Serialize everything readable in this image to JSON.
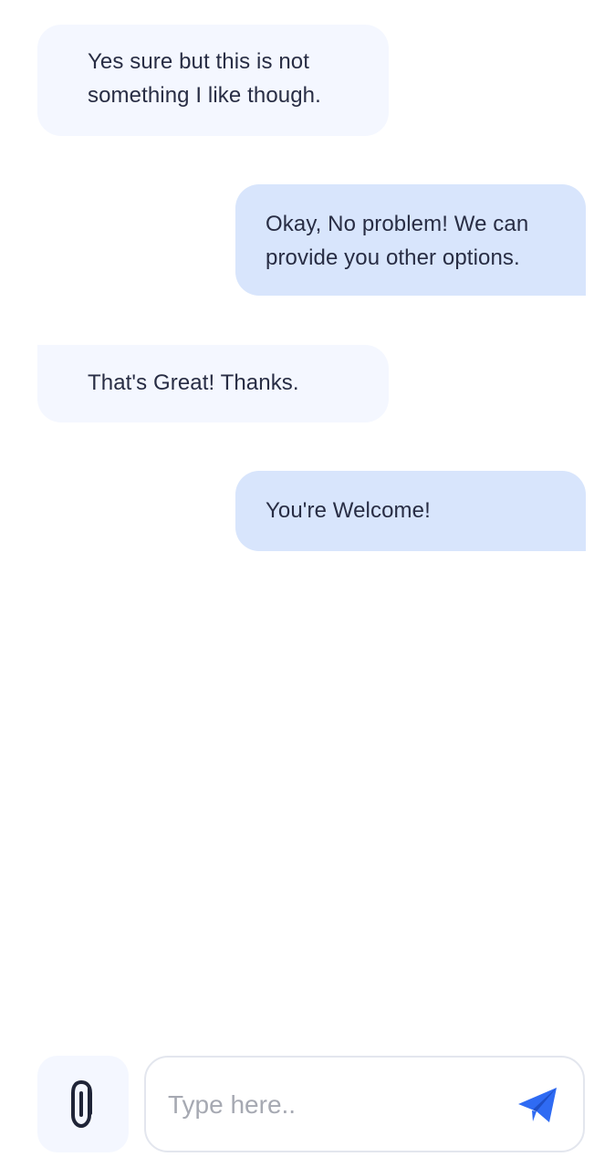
{
  "conversation": {
    "messages": [
      {
        "sender": "incoming",
        "text": "Yes sure but this is not something I like though."
      },
      {
        "sender": "outgoing",
        "text": "Okay, No problem! We can provide you other options."
      },
      {
        "sender": "incoming",
        "text": "That's Great! Thanks."
      },
      {
        "sender": "outgoing",
        "text": "You're Welcome!"
      }
    ]
  },
  "composer": {
    "placeholder": "Type here..",
    "value": "",
    "attach_icon": "paperclip-icon",
    "send_icon": "send-icon"
  },
  "colors": {
    "incoming_bubble": "#f4f7ff",
    "outgoing_bubble": "#d8e5fc",
    "send_accent": "#2f6bf3",
    "text": "#282d44",
    "placeholder": "#a6a9b2"
  }
}
